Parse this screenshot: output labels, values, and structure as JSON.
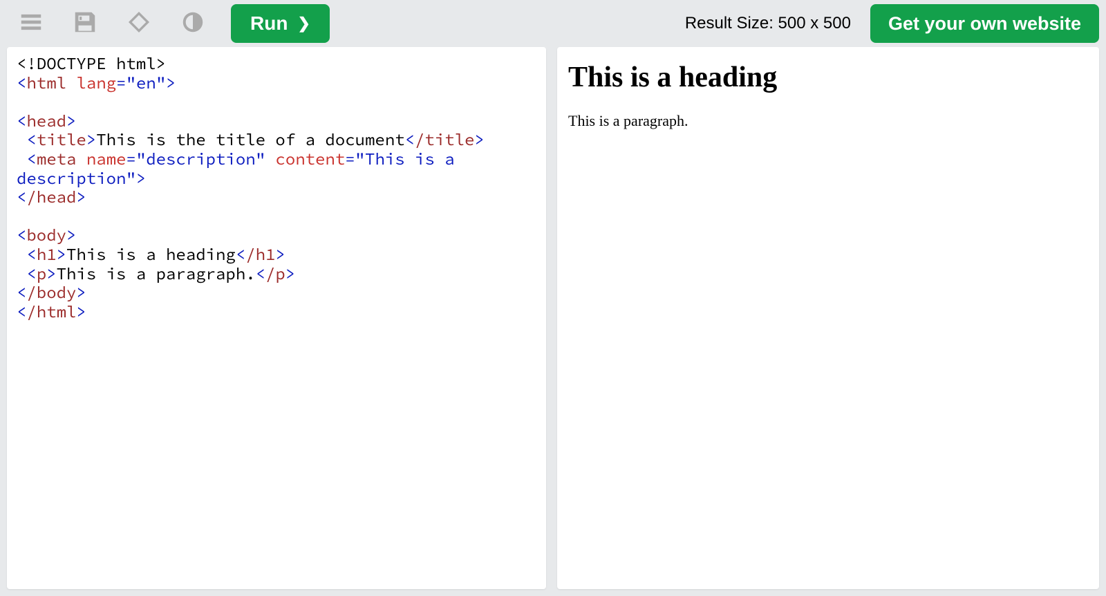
{
  "toolbar": {
    "run_label": "Run",
    "result_size_label": "Result Size: 500 x 500",
    "own_website_label": "Get your own website"
  },
  "code": {
    "doctype": "<!DOCTYPE html>",
    "html_open_lt": "<",
    "html_tag": "html",
    "lang_attr": " lang",
    "lang_eq": "=",
    "lang_val": "\"en\"",
    "gt": ">",
    "head_open": "head",
    "title_open": "title",
    "title_text": "This is the title of a document",
    "title_close": "/title",
    "meta_open": "meta",
    "meta_name_attr": " name",
    "meta_name_val": "\"description\"",
    "meta_content_attr": " content",
    "meta_content_val": "\"This is a description\"",
    "head_close": "/head",
    "body_open": "body",
    "h1_open": "h1",
    "h1_text": "This is a heading",
    "h1_close": "/h1",
    "p_open": "p",
    "p_text": "This is a paragraph.",
    "p_close": "/p",
    "body_close": "/body",
    "html_close": "/html"
  },
  "result": {
    "heading": "This is a heading",
    "paragraph": "This is a paragraph."
  }
}
